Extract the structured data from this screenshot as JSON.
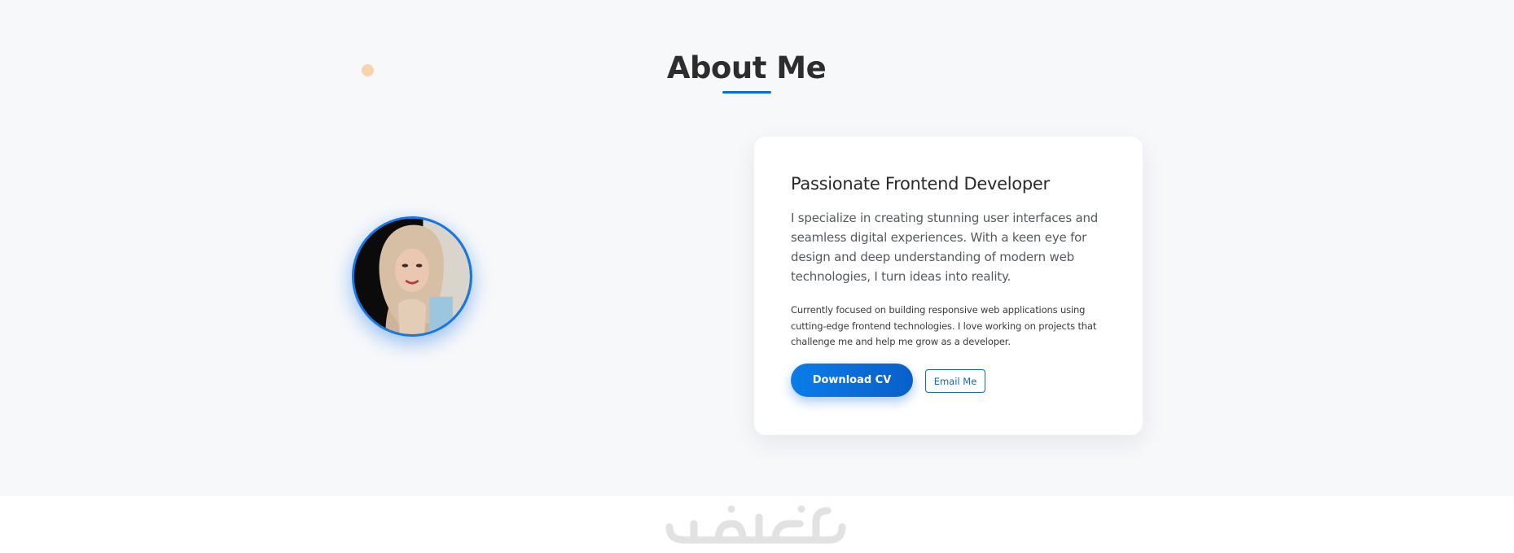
{
  "about": {
    "title": "About Me",
    "avatar_alt": "Profile photo"
  },
  "card": {
    "heading": "Passionate Frontend Developer",
    "lead": "I specialize in creating stunning user interfaces and seamless digital experiences. With a keen eye for design and deep understanding of modern web technologies, I turn ideas into reality.",
    "body": "Currently focused on building responsive web applications using cutting-edge frontend technologies. I love working on projects that challenge me and help me grow as a developer.",
    "primary_button": "Download CV",
    "secondary_button": "Email Me"
  },
  "watermark": {
    "text": "خمسات"
  },
  "colors": {
    "accent": "#0a6cd6",
    "section_bg": "#f7f8fa",
    "dot": "#f8d3ac"
  }
}
